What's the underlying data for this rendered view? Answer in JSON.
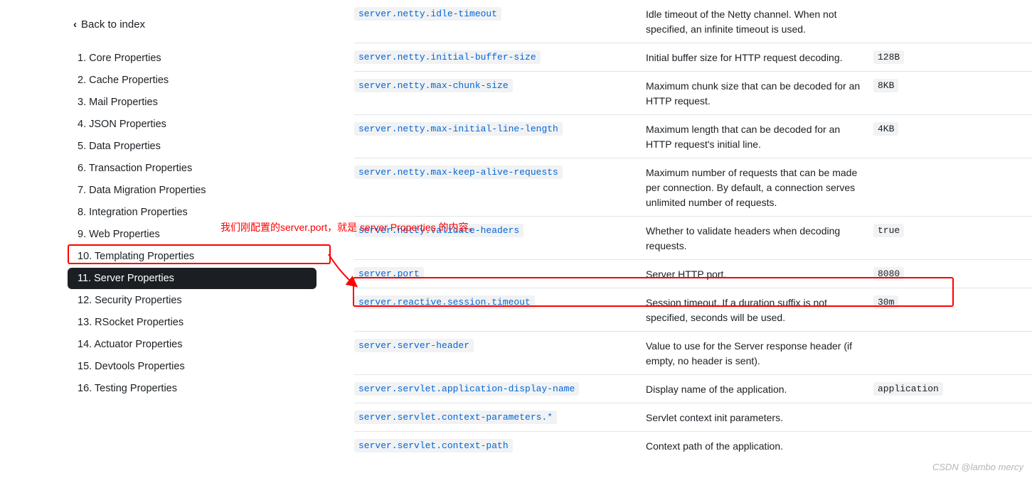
{
  "sidebar": {
    "back_label": "Back to index",
    "items": [
      {
        "label": "1. Core Properties"
      },
      {
        "label": "2. Cache Properties"
      },
      {
        "label": "3. Mail Properties"
      },
      {
        "label": "4. JSON Properties"
      },
      {
        "label": "5. Data Properties"
      },
      {
        "label": "6. Transaction Properties"
      },
      {
        "label": "7. Data Migration Properties"
      },
      {
        "label": "8. Integration Properties"
      },
      {
        "label": "9. Web Properties"
      },
      {
        "label": "10. Templating Properties"
      },
      {
        "label": "11. Server Properties"
      },
      {
        "label": "12. Security Properties"
      },
      {
        "label": "13. RSocket Properties"
      },
      {
        "label": "14. Actuator Properties"
      },
      {
        "label": "15. Devtools Properties"
      },
      {
        "label": "16. Testing Properties"
      }
    ],
    "active_index": 10
  },
  "main": {
    "rows": [
      {
        "name": "server.netty.idle-timeout",
        "desc": "Idle timeout of the Netty channel. When not specified, an infinite timeout is used.",
        "def": ""
      },
      {
        "name": "server.netty.initial-buffer-size",
        "desc": "Initial buffer size for HTTP request decoding.",
        "def": "128B"
      },
      {
        "name": "server.netty.max-chunk-size",
        "desc": "Maximum chunk size that can be decoded for an HTTP request.",
        "def": "8KB"
      },
      {
        "name": "server.netty.max-initial-line-length",
        "desc": "Maximum length that can be decoded for an HTTP request's initial line.",
        "def": "4KB"
      },
      {
        "name": "server.netty.max-keep-alive-requests",
        "desc": "Maximum number of requests that can be made per connection. By default, a connection serves unlimited number of requests.",
        "def": ""
      },
      {
        "name": "server.netty.validate-headers",
        "desc": "Whether to validate headers when decoding requests.",
        "def": "true"
      },
      {
        "name": "server.port",
        "desc": "Server HTTP port.",
        "def": "8080"
      },
      {
        "name": "server.reactive.session.timeout",
        "desc": "Session timeout. If a duration suffix is not specified, seconds will be used.",
        "def": "30m"
      },
      {
        "name": "server.server-header",
        "desc": "Value to use for the Server response header (if empty, no header is sent).",
        "def": ""
      },
      {
        "name": "server.servlet.application-display-name",
        "desc": "Display name of the application.",
        "def": "application"
      },
      {
        "name": "server.servlet.context-parameters.*",
        "desc": "Servlet context init parameters.",
        "def": ""
      },
      {
        "name": "server.servlet.context-path",
        "desc": "Context path of the application.",
        "def": ""
      }
    ]
  },
  "annotation": {
    "text": "我们刚配置的server.port，就是 server Properties 的内容。"
  },
  "watermark": "CSDN @lambo mercy"
}
